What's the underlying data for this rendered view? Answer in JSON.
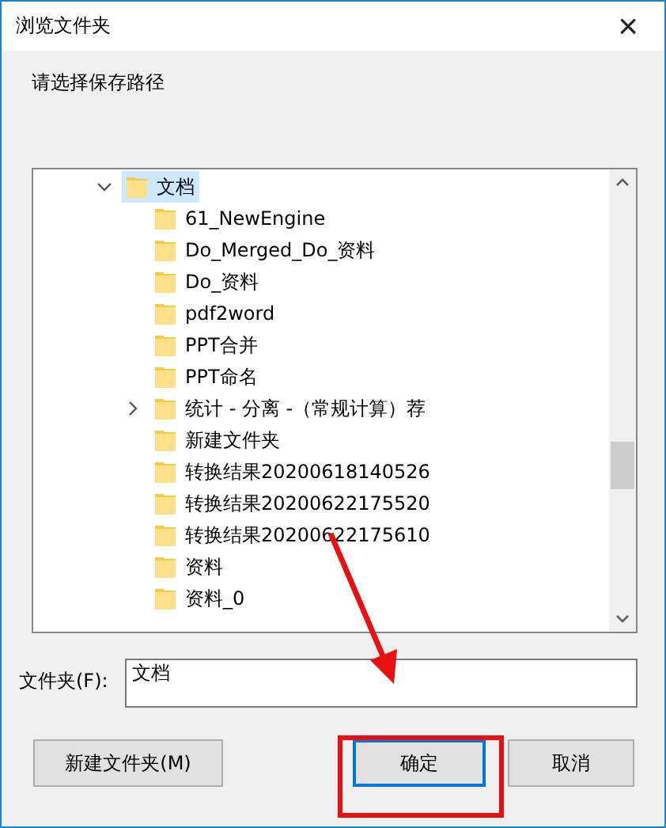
{
  "window": {
    "title": "浏览文件夹",
    "close": "×"
  },
  "prompt": "请选择保存路径",
  "tree": [
    {
      "label": "文档",
      "kind": "folder",
      "expanded": true,
      "selected": true,
      "children": [
        {
          "label": "61_NewEngine",
          "kind": "folder",
          "expandable": false,
          "selected": false
        },
        {
          "label": "Do_Merged_Do_资料",
          "kind": "folder",
          "expandable": false,
          "selected": false
        },
        {
          "label": "Do_资料",
          "kind": "folder",
          "expandable": false,
          "selected": false
        },
        {
          "label": "pdf2word",
          "kind": "folder",
          "expandable": false,
          "selected": false
        },
        {
          "label": "PPT合并",
          "kind": "folder",
          "expandable": false,
          "selected": false
        },
        {
          "label": "PPT命名",
          "kind": "folder",
          "expandable": false,
          "selected": false
        },
        {
          "label": "统计 - 分离 -（常规计算）荐",
          "kind": "folder",
          "expandable": true,
          "selected": false
        },
        {
          "label": "新建文件夹",
          "kind": "folder",
          "expandable": false,
          "selected": false
        },
        {
          "label": "转换结果20200618140526",
          "kind": "folder",
          "expandable": false,
          "selected": false
        },
        {
          "label": "转换结果20200622175520",
          "kind": "folder",
          "expandable": false,
          "selected": false
        },
        {
          "label": "转换结果20200622175610",
          "kind": "folder",
          "expandable": false,
          "selected": false
        },
        {
          "label": "资料",
          "kind": "folder",
          "expandable": false,
          "selected": false
        },
        {
          "label": "资料_0",
          "kind": "folder",
          "expandable": false,
          "selected": false
        }
      ]
    }
  ],
  "folder_field": {
    "label": "文件夹(F):",
    "value": "文档"
  },
  "buttons": [
    {
      "label": "新建文件夹(M)",
      "default": false
    },
    {
      "label": "确定",
      "default": true
    },
    {
      "label": "取消",
      "default": false
    }
  ],
  "annotations": {
    "arrow": true,
    "highlight": true
  }
}
